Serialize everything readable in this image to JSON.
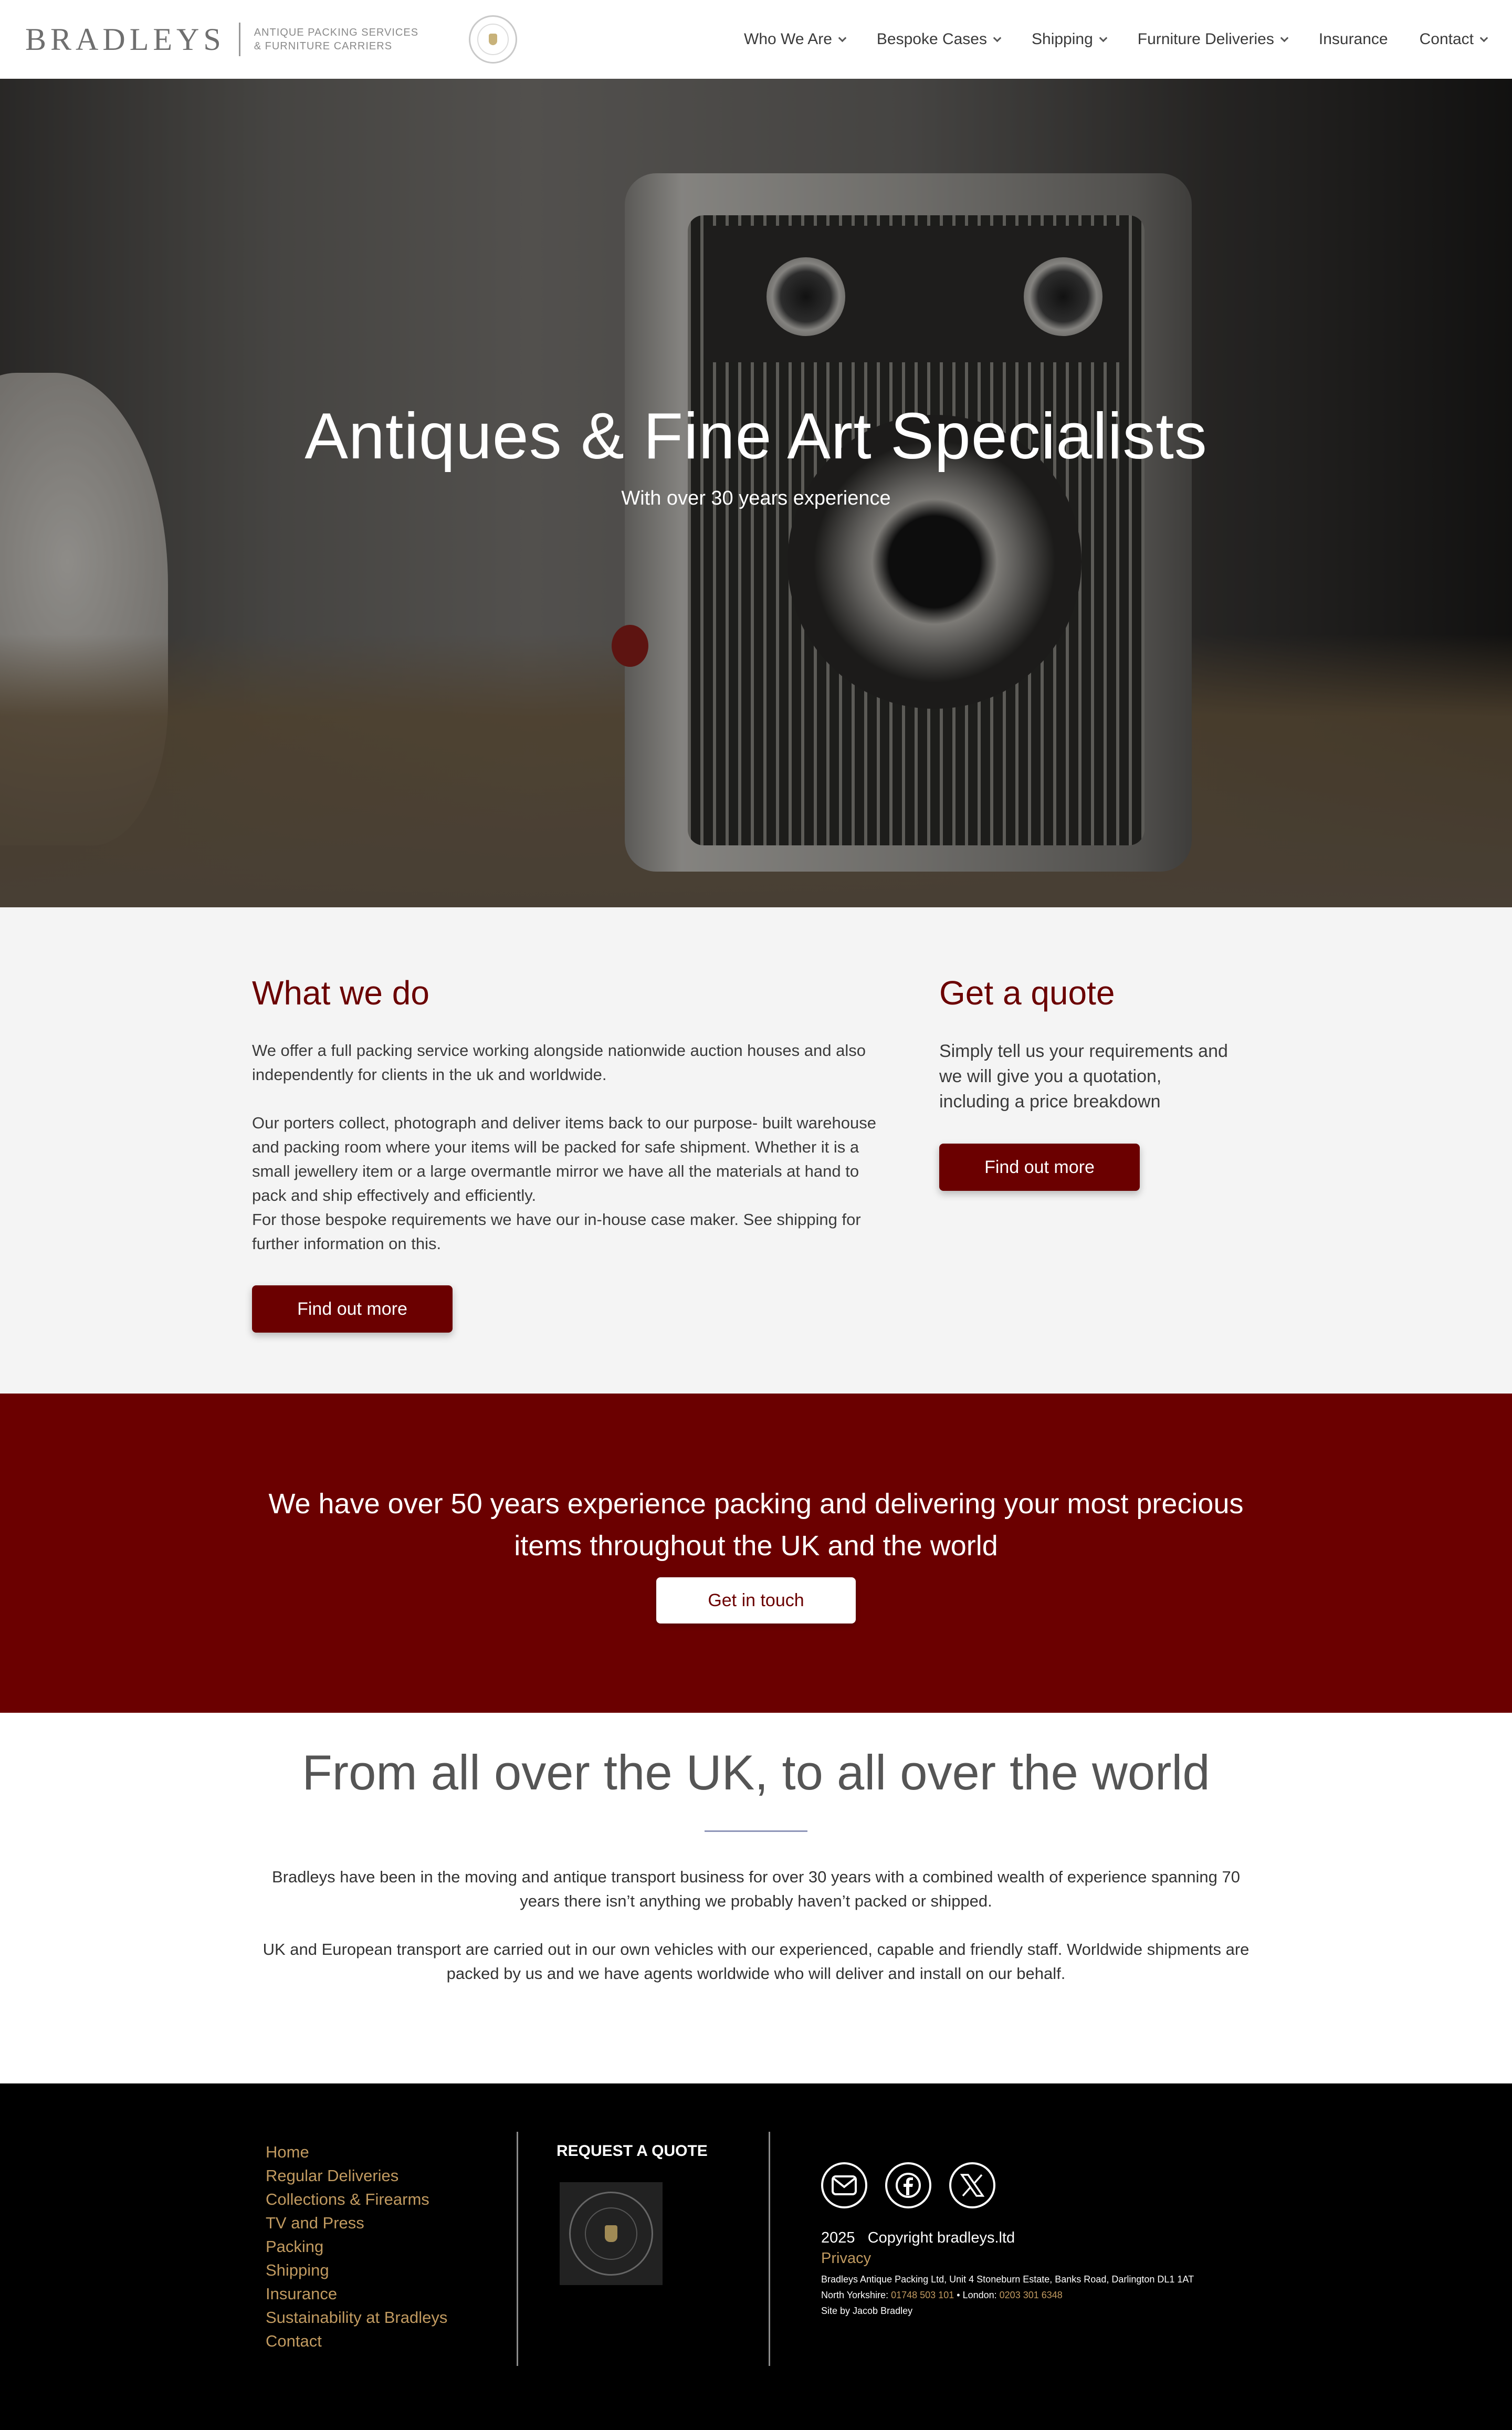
{
  "header": {
    "logo_word": "BRADLEYS",
    "logo_tag_line1": "Antique Packing Services",
    "logo_tag_line2": "& Furniture Carriers",
    "nav": [
      {
        "label": "Who We Are",
        "has_dropdown": true
      },
      {
        "label": "Bespoke Cases",
        "has_dropdown": true
      },
      {
        "label": "Shipping",
        "has_dropdown": true
      },
      {
        "label": "Furniture Deliveries",
        "has_dropdown": true
      },
      {
        "label": "Insurance",
        "has_dropdown": false
      },
      {
        "label": "Contact",
        "has_dropdown": true
      }
    ]
  },
  "hero": {
    "title": "Antiques & Fine Art Specialists",
    "subtitle": "With over 30 years experience"
  },
  "what_we_do": {
    "title": "What we do",
    "para1": "We offer a full packing service working alongside nationwide auction houses and also independently for clients in the uk and worldwide.",
    "para2": "Our porters collect, photograph and deliver items back to our purpose- built warehouse and packing room where your items will be packed for safe shipment. Whether it is a small jewellery item or a large overmantle mirror we have all the materials at hand to pack and ship effectively and efficiently.",
    "para3": "For those bespoke requirements we have our in-house case maker. See shipping for further information on this.",
    "button": "Find out more"
  },
  "get_quote": {
    "title": "Get a quote",
    "text": "Simply tell us your requirements and we will give you a quotation, including a price breakdown",
    "button": "Find out more"
  },
  "banner": {
    "text": "We have over 50 years experience packing and delivering your most precious items throughout the UK and the world",
    "button": "Get in touch"
  },
  "world": {
    "title": "From all over the UK, to all over the world",
    "para1": "Bradleys have been in the moving and antique transport business for over 30 years with a combined wealth of experience spanning 70 years there isn’t anything we probably haven’t packed or shipped.",
    "para2": "UK and European transport are carried out in our own vehicles with our experienced, capable and friendly staff. Worldwide shipments are packed by us and we have agents worldwide who will deliver and install on our behalf."
  },
  "footer": {
    "links": [
      "Home",
      "Regular Deliveries",
      "Collections & Firearms",
      "TV and Press",
      "Packing",
      "Shipping",
      "Insurance",
      "Sustainability at Bradleys",
      "Contact"
    ],
    "quote_label": "REQUEST A QUOTE",
    "social_icons": [
      "email-icon",
      "facebook-icon",
      "x-icon"
    ],
    "copyright_year": "2025",
    "copyright_text": "Copyright bradleys.ltd",
    "privacy": "Privacy",
    "address": "Bradleys Antique Packing Ltd, Unit 4 Stoneburn Estate, Banks Road, Darlington DL1 1AT",
    "north_label": "North Yorkshire:",
    "north_phone": "01748 503 101",
    "separator": "•",
    "london_label": "London:",
    "london_phone": "0203 301 6348",
    "credit": "Site by Jacob Bradley"
  },
  "colors": {
    "brand_red": "#6b0000",
    "footer_gold": "#c19a60",
    "footer_bg": "#000000",
    "section_grey": "#f4f4f4"
  }
}
